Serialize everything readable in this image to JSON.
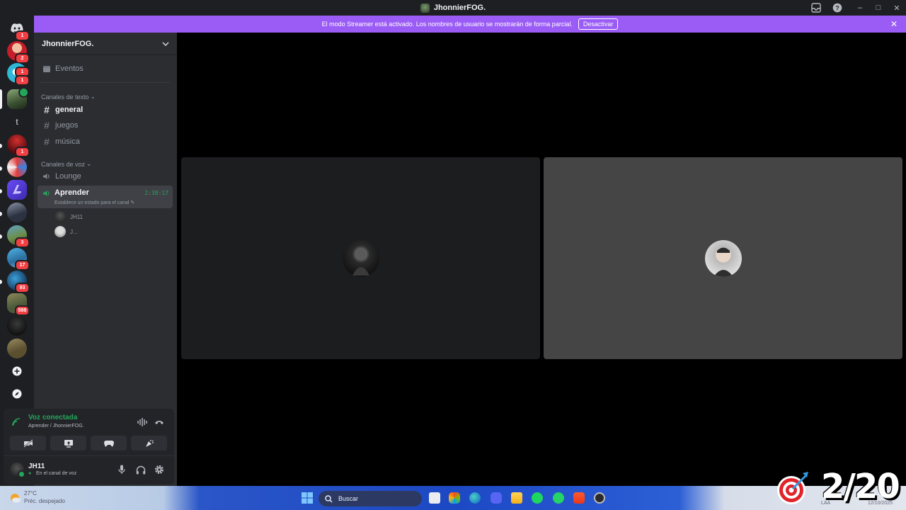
{
  "window": {
    "title": "JhonnierFOG."
  },
  "banner": {
    "message": "El modo Streamer está activado. Los nombres de usuario se mostrarán de forma parcial.",
    "button_label": "Desactivar"
  },
  "guilds": [
    {
      "name": "home",
      "badge": "1"
    },
    {
      "name": "dm-1",
      "badge": "2"
    },
    {
      "name": "dm-2",
      "badge": "1"
    },
    {
      "name": "dm-3",
      "badge": "1"
    },
    {
      "name": "server-active",
      "badge": ""
    },
    {
      "name": "server-t",
      "letter": "t",
      "badge": ""
    },
    {
      "name": "server-red",
      "badge": "1"
    },
    {
      "name": "server-8",
      "badge": ""
    },
    {
      "name": "server-9",
      "badge": ""
    },
    {
      "name": "server-10",
      "badge": ""
    },
    {
      "name": "server-11",
      "badge": "3"
    },
    {
      "name": "server-12",
      "badge": "17"
    },
    {
      "name": "server-13",
      "badge": "93"
    },
    {
      "name": "server-14",
      "badge": "598"
    },
    {
      "name": "server-15",
      "badge": ""
    },
    {
      "name": "server-16",
      "badge": ""
    }
  ],
  "sidebar": {
    "server_name": "JhonnierFOG.",
    "events_label": "Eventos",
    "text_category": "Canales de texto",
    "text_channels": [
      "general",
      "juegos",
      "música"
    ],
    "voice_category": "Canales de voz",
    "voice_channels": [
      "Lounge",
      "Aprender"
    ],
    "active_voice": {
      "name": "Aprender",
      "timer": "2:38:17",
      "status_hint": "Establece un estado para el canal"
    },
    "voice_users": [
      "JH11",
      "J..."
    ]
  },
  "panel": {
    "connection_title": "Voz conectada",
    "connection_sub": "Aprender / JhonnierFOG.",
    "username": "JH11",
    "user_status": "En el canal de voz"
  },
  "taskbar": {
    "weather_temp": "27°C",
    "weather_desc": "Préc. despejado",
    "search_placeholder": "Buscar",
    "lang": "LAA",
    "date": "12/10/2025"
  },
  "overlay": {
    "counter": "2/20"
  },
  "colors": {
    "banner": "#9b5cf6",
    "connected_green": "#23a55a",
    "badge_red": "#f23f43"
  }
}
